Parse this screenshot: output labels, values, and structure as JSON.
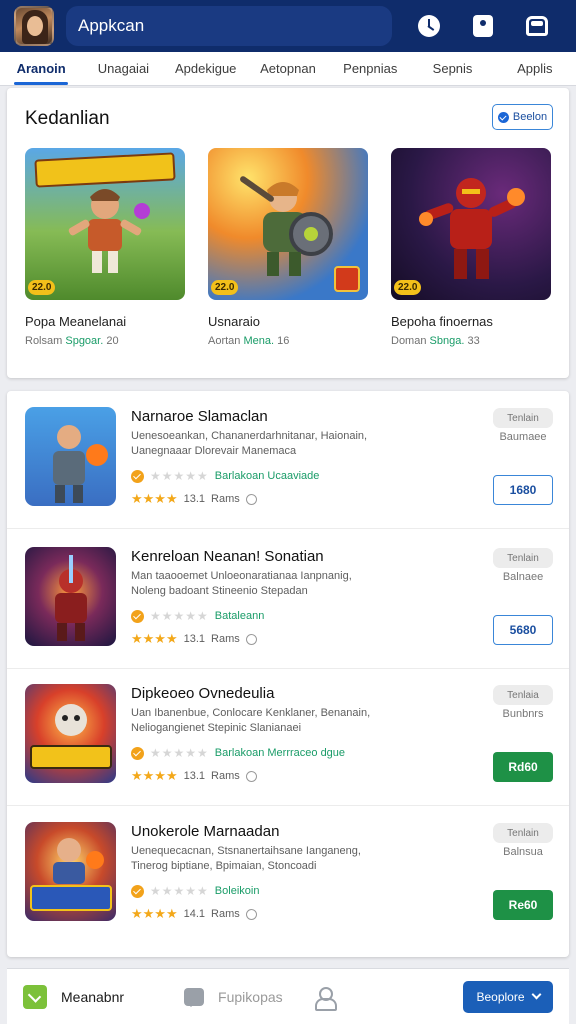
{
  "header": {
    "title": "Appkcan",
    "icons": [
      "clock-icon",
      "badge-icon",
      "bus-icon"
    ],
    "accent": "#0f2c6b"
  },
  "tabs": [
    {
      "label": "Aranoin",
      "active": true
    },
    {
      "label": "Unagaiai",
      "active": false
    },
    {
      "label": "Apdekigue",
      "active": false
    },
    {
      "label": "Aetopnan",
      "active": false
    },
    {
      "label": "Penpnias",
      "active": false
    },
    {
      "label": "Sepnis",
      "active": false
    },
    {
      "label": "Applis",
      "active": false
    }
  ],
  "featured": {
    "title": "Kedanlian",
    "button_label": "Beelon",
    "items": [
      {
        "name": "Popa Meanelanai",
        "meta_label": "Rolsam",
        "publisher": "Spgoar.",
        "count": "20",
        "badge": "22.0",
        "image": "kawean-hero-art"
      },
      {
        "name": "Usnaraio",
        "meta_label": "Aortan",
        "publisher": "Mena.",
        "count": "16",
        "badge": "22.0",
        "image": "armored-warrior-art"
      },
      {
        "name": "Bepoha finoernas",
        "meta_label": "Doman",
        "publisher": "Sbnga.",
        "count": "33",
        "badge": "22.0",
        "image": "red-knight-art"
      }
    ]
  },
  "apps": [
    {
      "title": "Narnaroe Slamaclan",
      "desc_line1": "Uenesoeankan, Chananerdarhnitanar, Haionain,",
      "desc_line2": "Uanegnaaar Dlorevair Manemaca",
      "publisher": "Barlakoan Ucaaviade",
      "rating": "13.1",
      "ratings_word": "Rams",
      "tag": "Tenlain",
      "sub": "Baumaee",
      "price": "1680",
      "price_style": "outline"
    },
    {
      "title": "Kenreloan Neanan! Sonatian",
      "desc_line1": "Man taaooemet Unloeonaratianaa Ianpnanig,",
      "desc_line2": "Noleng badoant Stineenio Stepadan",
      "publisher": "Bataleann",
      "rating": "13.1",
      "ratings_word": "Rams",
      "tag": "Tenlain",
      "sub": "Balnaee",
      "price": "5680",
      "price_style": "outline"
    },
    {
      "title": "Dipkeoeo Ovnedeulia",
      "desc_line1": "Uan Ibanenbue, Conlocare Kenklaner, Benanain,",
      "desc_line2": "Neliogangienet Stepinic Slanianaei",
      "publisher": "Barlakoan Merrraceo dgue",
      "rating": "13.1",
      "ratings_word": "Rams",
      "tag": "Tenlaia",
      "sub": "Bunbnrs",
      "price": "Rd60",
      "price_style": "filled"
    },
    {
      "title": "Unokerole Marnaadan",
      "desc_line1": "Uenequecacnan, Stsnanertaihsane Ianganeng,",
      "desc_line2": "Tinerog biptiane, Bpimaian, Stoncoadi",
      "publisher": "Boleikoin",
      "rating": "14.1",
      "ratings_word": "Rams",
      "tag": "Tenlain",
      "sub": "Balnsua",
      "price": "Re60",
      "price_style": "filled"
    }
  ],
  "bottom_nav": {
    "home_label": "Meanabnr",
    "messages_label": "Fupikopas",
    "action_label": "Beoplore"
  }
}
